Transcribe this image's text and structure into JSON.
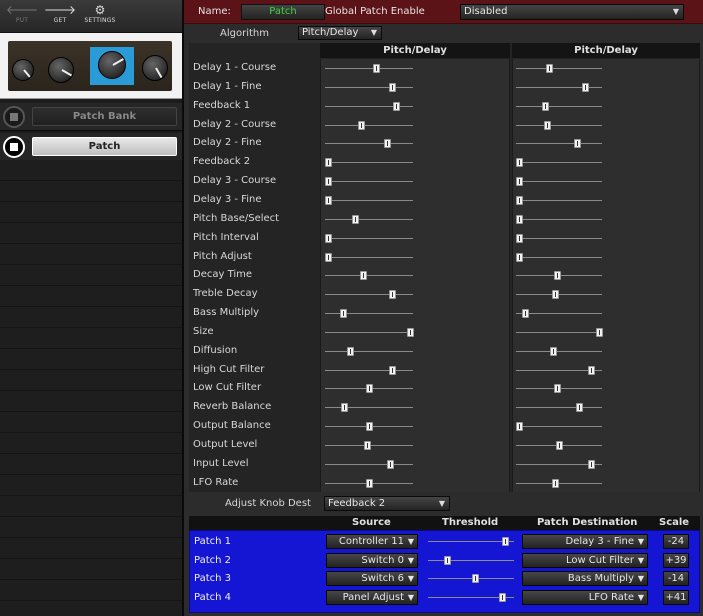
{
  "toolbar": {
    "put_label": "PUT",
    "get_label": "GET",
    "settings_label": "SETTINGS"
  },
  "nav": {
    "patch_bank_label": "Patch Bank",
    "patch_label": "Patch"
  },
  "header": {
    "name_label": "Name:",
    "name_value": "Patch",
    "global_enable_label": "Global Patch Enable",
    "global_enable_value": "Disabled",
    "algorithm_label": "Algorithm",
    "algorithm_value": "Pitch/Delay"
  },
  "columns": [
    "Pitch/Delay",
    "Pitch/Delay"
  ],
  "params": [
    {
      "label": "Delay 1 - Course",
      "v1": 0.58,
      "v2": 0.38
    },
    {
      "label": "Delay 1 - Fine",
      "v1": 0.78,
      "v2": 0.82
    },
    {
      "label": "Feedback 1",
      "v1": 0.83,
      "v2": 0.33
    },
    {
      "label": "Delay 2 - Course",
      "v1": 0.4,
      "v2": 0.35
    },
    {
      "label": "Delay 2 - Fine",
      "v1": 0.72,
      "v2": 0.72
    },
    {
      "label": "Feedback 2",
      "v1": 0.0,
      "v2": 0.0
    },
    {
      "label": "Delay 3 - Course",
      "v1": 0.0,
      "v2": 0.0
    },
    {
      "label": "Delay 3 - Fine",
      "v1": 0.0,
      "v2": 0.0
    },
    {
      "label": "Pitch Base/Select",
      "v1": 0.33,
      "v2": 0.0
    },
    {
      "label": "Pitch Interval",
      "v1": 0.0,
      "v2": 0.0
    },
    {
      "label": "Pitch Adjust",
      "v1": 0.0,
      "v2": 0.0
    },
    {
      "label": "Decay Time",
      "v1": 0.43,
      "v2": 0.47
    },
    {
      "label": "Treble Decay",
      "v1": 0.78,
      "v2": 0.45
    },
    {
      "label": "Bass Multiply",
      "v1": 0.18,
      "v2": 0.08
    },
    {
      "label": "Size",
      "v1": 1.0,
      "v2": 1.0
    },
    {
      "label": "Diffusion",
      "v1": 0.27,
      "v2": 0.42
    },
    {
      "label": "High Cut Filter",
      "v1": 0.78,
      "v2": 0.9
    },
    {
      "label": "Low Cut Filter",
      "v1": 0.5,
      "v2": 0.48
    },
    {
      "label": "Reverb Balance",
      "v1": 0.2,
      "v2": 0.75
    },
    {
      "label": "Output Balance",
      "v1": 0.5,
      "v2": 0.0
    },
    {
      "label": "Output Level",
      "v1": 0.48,
      "v2": 0.5
    },
    {
      "label": "Input Level",
      "v1": 0.75,
      "v2": 0.9
    },
    {
      "label": "LFO Rate",
      "v1": 0.5,
      "v2": 0.45
    }
  ],
  "adjust_knob": {
    "label": "Adjust Knob Dest",
    "value": "Feedback 2"
  },
  "patch_matrix": {
    "headers": {
      "source": "Source",
      "threshold": "Threshold",
      "destination": "Patch Destination",
      "scale": "Scale"
    },
    "rows": [
      {
        "label": "Patch 1",
        "source": "Controller 11",
        "threshold": 0.93,
        "destination": "Delay 3 - Fine",
        "scale": "-24"
      },
      {
        "label": "Patch 2",
        "source": "Switch 0",
        "threshold": 0.2,
        "destination": "Low Cut Filter",
        "scale": "+39"
      },
      {
        "label": "Patch 3",
        "source": "Switch 6",
        "threshold": 0.55,
        "destination": "Bass Multiply",
        "scale": "-14"
      },
      {
        "label": "Patch 4",
        "source": "Panel Adjust",
        "threshold": 0.89,
        "destination": "LFO Rate",
        "scale": "+41"
      }
    ]
  }
}
